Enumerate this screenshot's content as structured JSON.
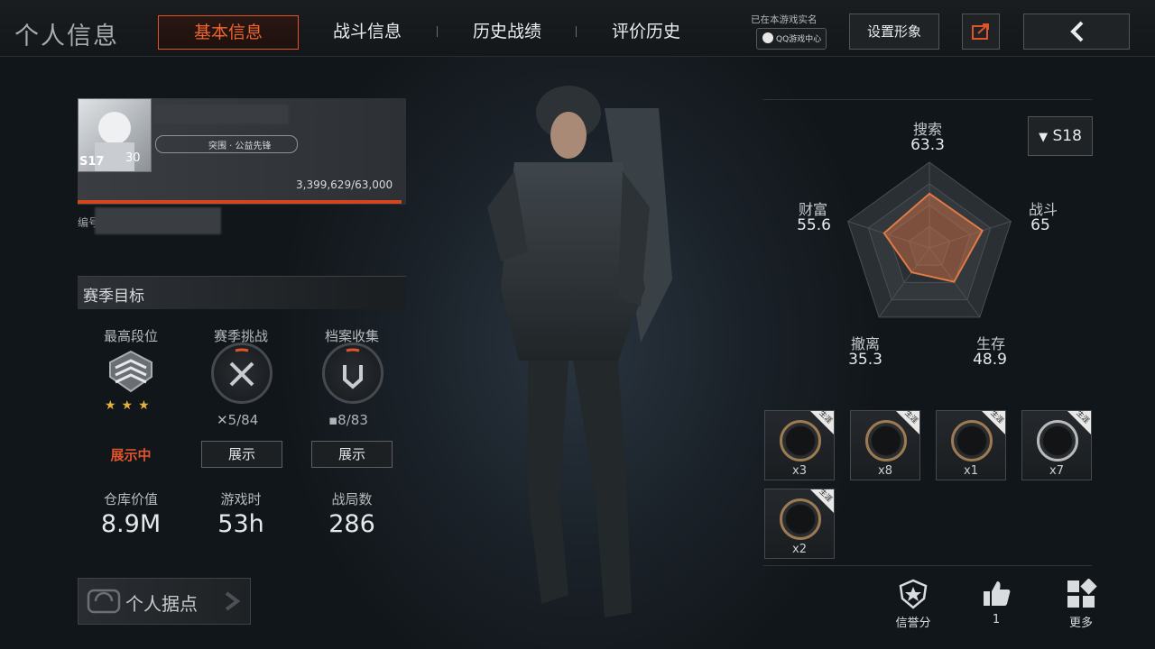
{
  "header": {
    "title": "个人信息",
    "tabs": [
      "基本信息",
      "战斗信息",
      "历史战绩",
      "评价历史"
    ],
    "realname_text": "已在本游戏实名",
    "qq_badge": "QQ游戏中心",
    "set_image_label": "设置形象"
  },
  "profile": {
    "season_badge": "S17",
    "level": "30",
    "tags": "突围 · 公益先锋",
    "exp_text": "3,399,629/63,000",
    "id_label": "编号"
  },
  "season_goals": {
    "title": "赛季目标",
    "columns": [
      {
        "label": "最高段位",
        "sub": "展示中"
      },
      {
        "label": "赛季挑战",
        "progress": "5/84",
        "button": "展示"
      },
      {
        "label": "档案收集",
        "progress": "8/83",
        "button": "展示"
      }
    ]
  },
  "stats": [
    {
      "label": "仓库价值",
      "value": "8.9M"
    },
    {
      "label": "游戏时",
      "value": "53h"
    },
    {
      "label": "战局数",
      "value": "286"
    }
  ],
  "base_button": "个人据点",
  "season_select": "S18",
  "radar": {
    "axes": [
      {
        "label": "搜索",
        "value": "63.3"
      },
      {
        "label": "战斗",
        "value": "65"
      },
      {
        "label": "生存",
        "value": "48.9"
      },
      {
        "label": "撤离",
        "value": "35.3"
      },
      {
        "label": "财富",
        "value": "55.6"
      }
    ],
    "color": "#e07a46"
  },
  "items": {
    "tag": "生涯",
    "counts": [
      "x3",
      "x8",
      "x1",
      "x7",
      "x2"
    ]
  },
  "bottom_actions": [
    {
      "label": "信誉分",
      "icon": "shield-star-icon"
    },
    {
      "label": "1",
      "icon": "thumbs-up-icon"
    },
    {
      "label": "更多",
      "icon": "grid-icon"
    }
  ],
  "colors": {
    "accent": "#e0532b",
    "bg": "#0f1316"
  }
}
